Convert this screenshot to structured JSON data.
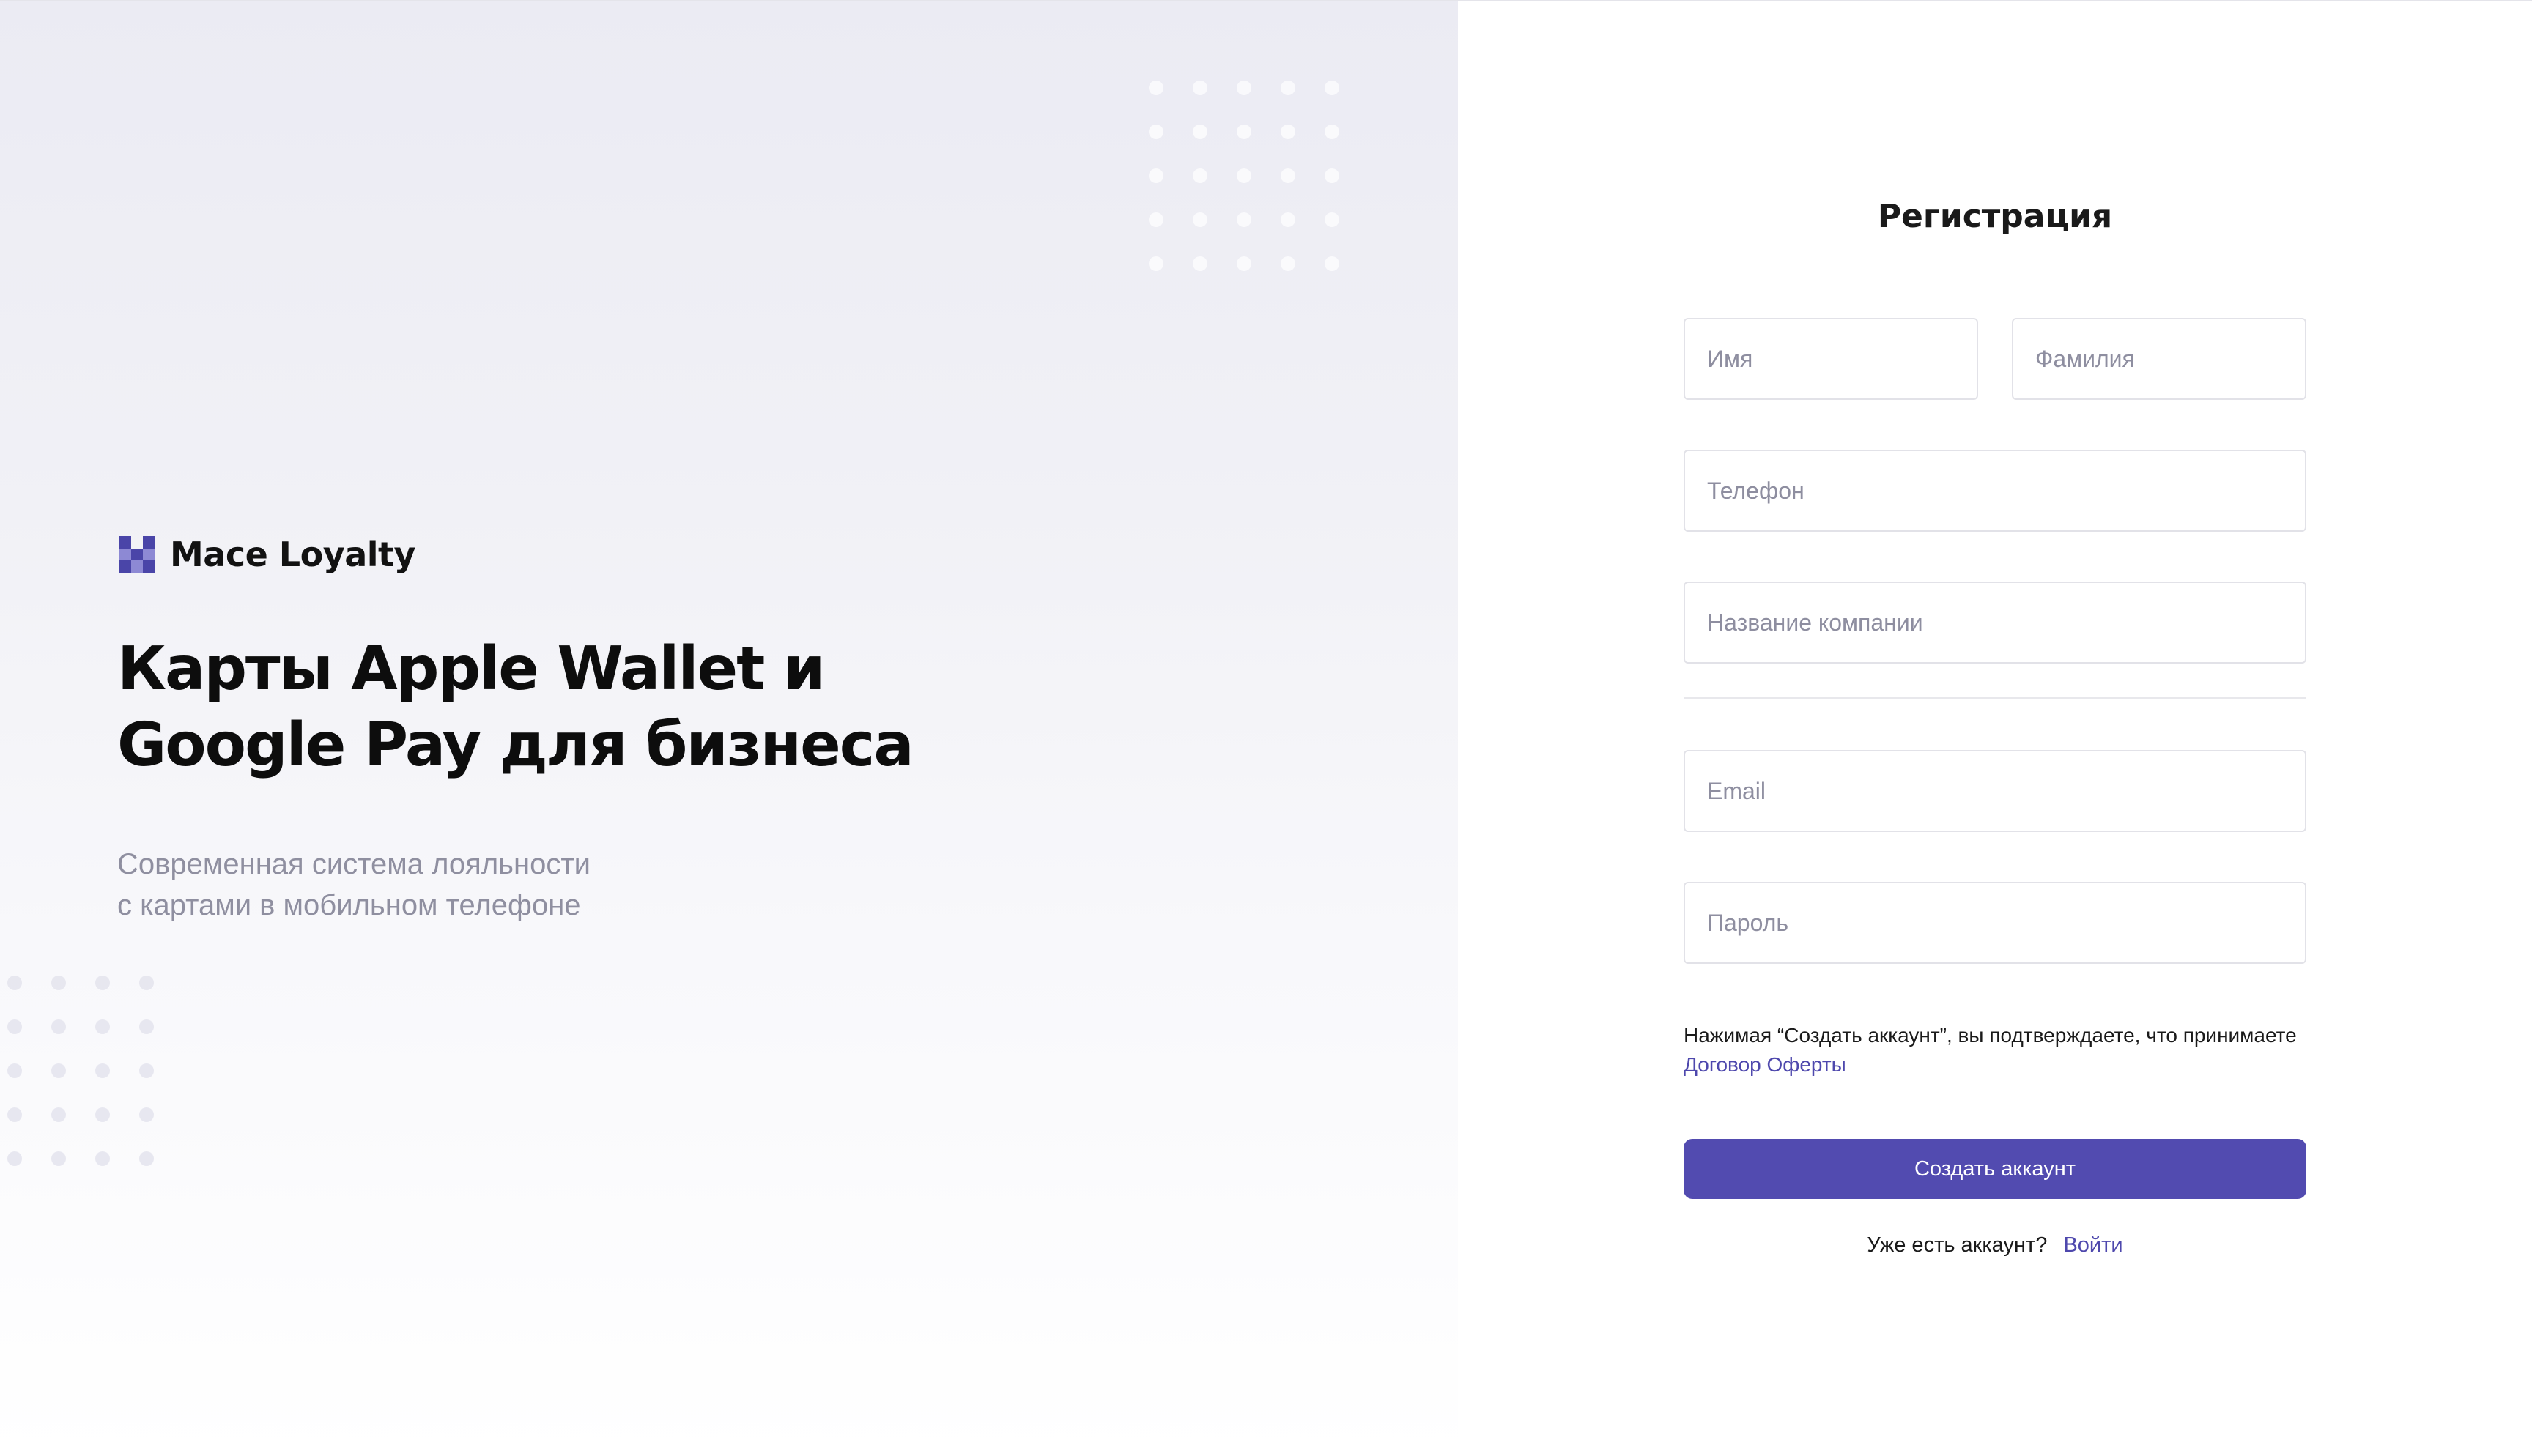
{
  "brand": {
    "name": "Mace Loyalty",
    "logo_icon": "checker-grid-logo",
    "accent_color": "#524bb0"
  },
  "hero": {
    "title": "Карты Apple Wallet и\nGoogle Pay для бизнеса",
    "subtitle": "Современная система лояльности\nс картами в мобильном телефоне"
  },
  "form": {
    "title": "Регистрация",
    "first_name_placeholder": "Имя",
    "last_name_placeholder": "Фамилия",
    "phone_placeholder": "Телефон",
    "company_placeholder": "Название компании",
    "email_placeholder": "Email",
    "password_placeholder": "Пароль",
    "terms_text": "Нажимая “Создать аккаунт”, вы подтверждаете, что принимаете",
    "terms_link": "Договор Оферты",
    "submit_label": "Создать аккаунт",
    "have_account_text": "Уже есть аккаунт?",
    "login_link": "Войти"
  }
}
